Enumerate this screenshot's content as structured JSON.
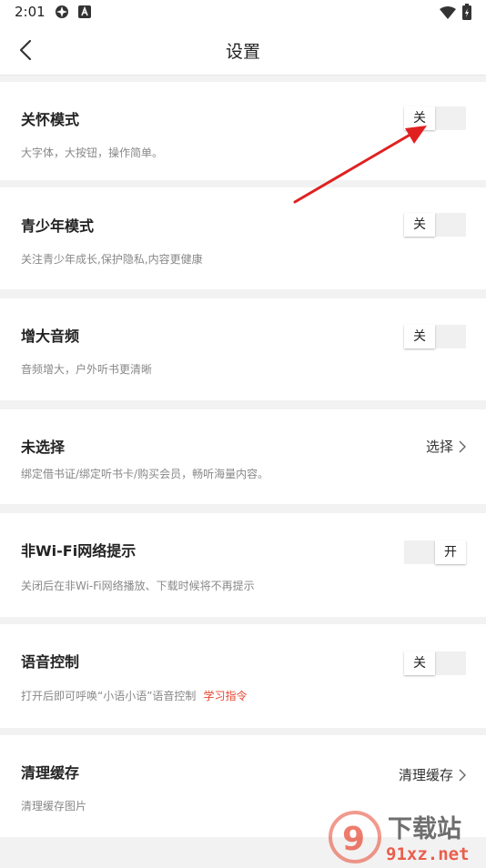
{
  "status": {
    "time": "2:01"
  },
  "header": {
    "title": "设置"
  },
  "settings": [
    {
      "title": "关怀模式",
      "desc": "大字体，大按钮，操作简单。",
      "control": "toggle",
      "state": "off",
      "toggle_label": "关"
    },
    {
      "title": "青少年模式",
      "desc": "关注青少年成长,保护隐私,内容更健康",
      "control": "toggle",
      "state": "off",
      "toggle_label": "关"
    },
    {
      "title": "增大音频",
      "desc": "音频增大，户外听书更清晰",
      "control": "toggle",
      "state": "off",
      "toggle_label": "关"
    },
    {
      "title": "未选择",
      "desc": "绑定借书证/绑定听书卡/购买会员，畅听海量内容。",
      "control": "action",
      "action_label": "选择"
    },
    {
      "title": "非Wi-Fi网络提示",
      "desc": "关闭后在非Wi-Fi网络播放、下载时候将不再提示",
      "control": "toggle",
      "state": "on",
      "toggle_label": "开"
    },
    {
      "title": "语音控制",
      "desc": "打开后即可呼唤“小语小语”语音控制",
      "link": "学习指令",
      "control": "toggle",
      "state": "off",
      "toggle_label": "关"
    },
    {
      "title": "清理缓存",
      "desc": "清理缓存图片",
      "control": "action",
      "action_label": "清理缓存"
    }
  ],
  "watermark": {
    "text1": "下载站",
    "text2": "91xz.net"
  },
  "colors": {
    "accent": "#e8452f",
    "arrow": "#e02020"
  }
}
